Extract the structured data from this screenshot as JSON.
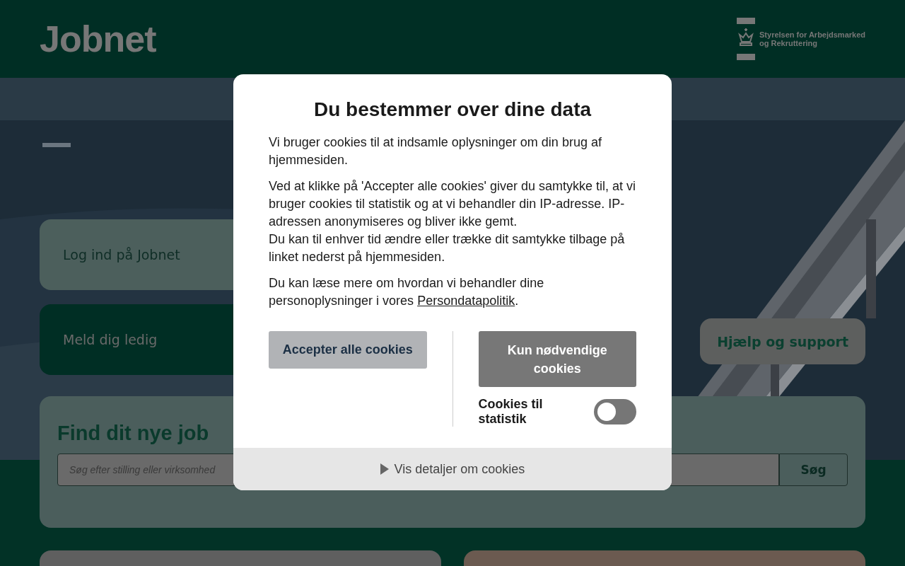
{
  "header": {
    "logo": "Jobnet",
    "agency_lines": [
      "Styrelsen for Arbejdsmarked",
      "og Rekruttering"
    ]
  },
  "hero": {
    "kind": "picture",
    "links": [
      {
        "label": "Log ind på Jobnet",
        "kind": "light"
      },
      {
        "label": "Meld dig ledig",
        "kind": "dark"
      }
    ],
    "help_button": "Hjælp og support"
  },
  "search": {
    "title": "Find dit nye job",
    "placeholder": "Søg efter stilling eller virksomhed",
    "button": "Søg"
  },
  "cookie_dialog": {
    "title": "Du bestemmer over dine data",
    "paragraphs": [
      "Vi bruger cookies til at indsamle oplysninger om din brug af hjemmesiden.",
      "Ved at klikke på 'Accepter alle cookies' giver du samtykke til, at vi bruger cookies til statistik og at vi behandler din IP-adresse. IP-adressen anonymiseres og bliver ikke gemt.\nDu kan til enhver tid ændre eller trække dit samtykke tilbage på linket nederst på hjemmesiden."
    ],
    "policy": {
      "before": "Du kan læse mere om hvordan vi behandler dine personoplysninger i vores ",
      "link": "Persondatapolitik",
      "after": "."
    },
    "accept_button": "Accepter alle cookies",
    "necessary_button": "Kun nødvendige cookies",
    "toggle": {
      "label": "Cookies til statistik",
      "on": false
    },
    "details": {
      "label": "Vis detaljer om cookies",
      "expanded": false
    }
  }
}
